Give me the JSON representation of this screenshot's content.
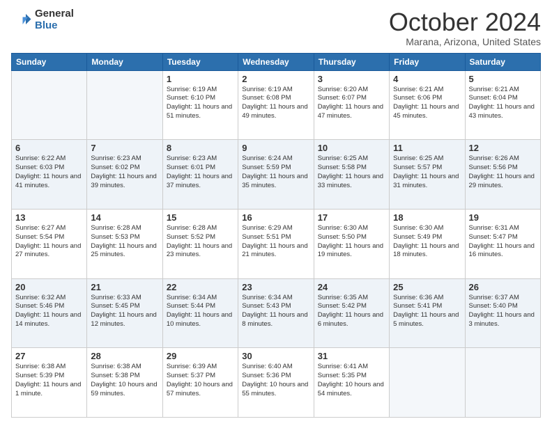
{
  "logo": {
    "general": "General",
    "blue": "Blue"
  },
  "header": {
    "month": "October 2024",
    "location": "Marana, Arizona, United States"
  },
  "weekdays": [
    "Sunday",
    "Monday",
    "Tuesday",
    "Wednesday",
    "Thursday",
    "Friday",
    "Saturday"
  ],
  "weeks": [
    [
      {
        "day": "",
        "info": ""
      },
      {
        "day": "",
        "info": ""
      },
      {
        "day": "1",
        "info": "Sunrise: 6:19 AM\nSunset: 6:10 PM\nDaylight: 11 hours and 51 minutes."
      },
      {
        "day": "2",
        "info": "Sunrise: 6:19 AM\nSunset: 6:08 PM\nDaylight: 11 hours and 49 minutes."
      },
      {
        "day": "3",
        "info": "Sunrise: 6:20 AM\nSunset: 6:07 PM\nDaylight: 11 hours and 47 minutes."
      },
      {
        "day": "4",
        "info": "Sunrise: 6:21 AM\nSunset: 6:06 PM\nDaylight: 11 hours and 45 minutes."
      },
      {
        "day": "5",
        "info": "Sunrise: 6:21 AM\nSunset: 6:04 PM\nDaylight: 11 hours and 43 minutes."
      }
    ],
    [
      {
        "day": "6",
        "info": "Sunrise: 6:22 AM\nSunset: 6:03 PM\nDaylight: 11 hours and 41 minutes."
      },
      {
        "day": "7",
        "info": "Sunrise: 6:23 AM\nSunset: 6:02 PM\nDaylight: 11 hours and 39 minutes."
      },
      {
        "day": "8",
        "info": "Sunrise: 6:23 AM\nSunset: 6:01 PM\nDaylight: 11 hours and 37 minutes."
      },
      {
        "day": "9",
        "info": "Sunrise: 6:24 AM\nSunset: 5:59 PM\nDaylight: 11 hours and 35 minutes."
      },
      {
        "day": "10",
        "info": "Sunrise: 6:25 AM\nSunset: 5:58 PM\nDaylight: 11 hours and 33 minutes."
      },
      {
        "day": "11",
        "info": "Sunrise: 6:25 AM\nSunset: 5:57 PM\nDaylight: 11 hours and 31 minutes."
      },
      {
        "day": "12",
        "info": "Sunrise: 6:26 AM\nSunset: 5:56 PM\nDaylight: 11 hours and 29 minutes."
      }
    ],
    [
      {
        "day": "13",
        "info": "Sunrise: 6:27 AM\nSunset: 5:54 PM\nDaylight: 11 hours and 27 minutes."
      },
      {
        "day": "14",
        "info": "Sunrise: 6:28 AM\nSunset: 5:53 PM\nDaylight: 11 hours and 25 minutes."
      },
      {
        "day": "15",
        "info": "Sunrise: 6:28 AM\nSunset: 5:52 PM\nDaylight: 11 hours and 23 minutes."
      },
      {
        "day": "16",
        "info": "Sunrise: 6:29 AM\nSunset: 5:51 PM\nDaylight: 11 hours and 21 minutes."
      },
      {
        "day": "17",
        "info": "Sunrise: 6:30 AM\nSunset: 5:50 PM\nDaylight: 11 hours and 19 minutes."
      },
      {
        "day": "18",
        "info": "Sunrise: 6:30 AM\nSunset: 5:49 PM\nDaylight: 11 hours and 18 minutes."
      },
      {
        "day": "19",
        "info": "Sunrise: 6:31 AM\nSunset: 5:47 PM\nDaylight: 11 hours and 16 minutes."
      }
    ],
    [
      {
        "day": "20",
        "info": "Sunrise: 6:32 AM\nSunset: 5:46 PM\nDaylight: 11 hours and 14 minutes."
      },
      {
        "day": "21",
        "info": "Sunrise: 6:33 AM\nSunset: 5:45 PM\nDaylight: 11 hours and 12 minutes."
      },
      {
        "day": "22",
        "info": "Sunrise: 6:34 AM\nSunset: 5:44 PM\nDaylight: 11 hours and 10 minutes."
      },
      {
        "day": "23",
        "info": "Sunrise: 6:34 AM\nSunset: 5:43 PM\nDaylight: 11 hours and 8 minutes."
      },
      {
        "day": "24",
        "info": "Sunrise: 6:35 AM\nSunset: 5:42 PM\nDaylight: 11 hours and 6 minutes."
      },
      {
        "day": "25",
        "info": "Sunrise: 6:36 AM\nSunset: 5:41 PM\nDaylight: 11 hours and 5 minutes."
      },
      {
        "day": "26",
        "info": "Sunrise: 6:37 AM\nSunset: 5:40 PM\nDaylight: 11 hours and 3 minutes."
      }
    ],
    [
      {
        "day": "27",
        "info": "Sunrise: 6:38 AM\nSunset: 5:39 PM\nDaylight: 11 hours and 1 minute."
      },
      {
        "day": "28",
        "info": "Sunrise: 6:38 AM\nSunset: 5:38 PM\nDaylight: 10 hours and 59 minutes."
      },
      {
        "day": "29",
        "info": "Sunrise: 6:39 AM\nSunset: 5:37 PM\nDaylight: 10 hours and 57 minutes."
      },
      {
        "day": "30",
        "info": "Sunrise: 6:40 AM\nSunset: 5:36 PM\nDaylight: 10 hours and 55 minutes."
      },
      {
        "day": "31",
        "info": "Sunrise: 6:41 AM\nSunset: 5:35 PM\nDaylight: 10 hours and 54 minutes."
      },
      {
        "day": "",
        "info": ""
      },
      {
        "day": "",
        "info": ""
      }
    ]
  ]
}
